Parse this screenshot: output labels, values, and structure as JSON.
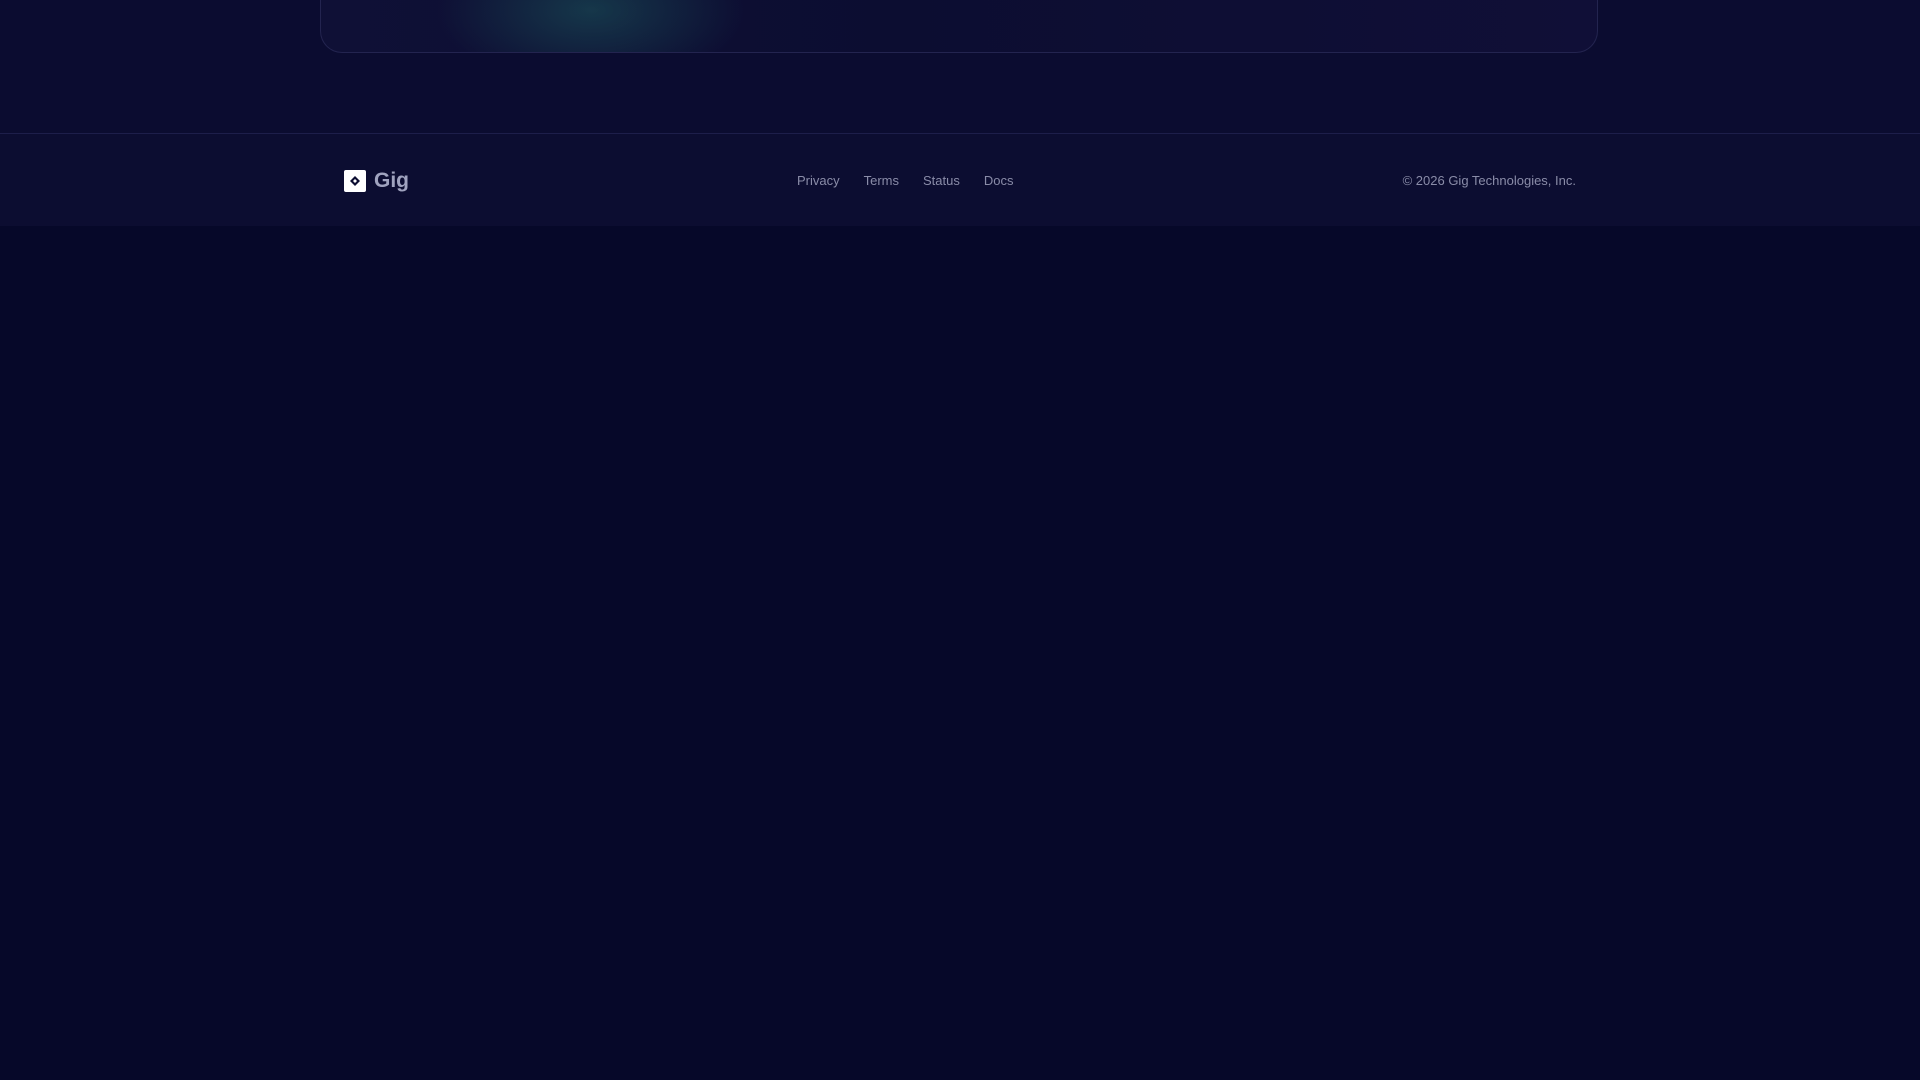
{
  "footer": {
    "brand_name": "Gig",
    "links": [
      {
        "label": "Privacy"
      },
      {
        "label": "Terms"
      },
      {
        "label": "Status"
      },
      {
        "label": "Docs"
      }
    ],
    "copyright": "© 2026 Gig Technologies, Inc."
  },
  "icons": {
    "logo": "diamond-logo-icon"
  },
  "colors": {
    "page_background": "#060829",
    "footer_background": "#0c0d31",
    "text_muted": "#8a8ca8",
    "logo_accent": "#0c0d31"
  }
}
